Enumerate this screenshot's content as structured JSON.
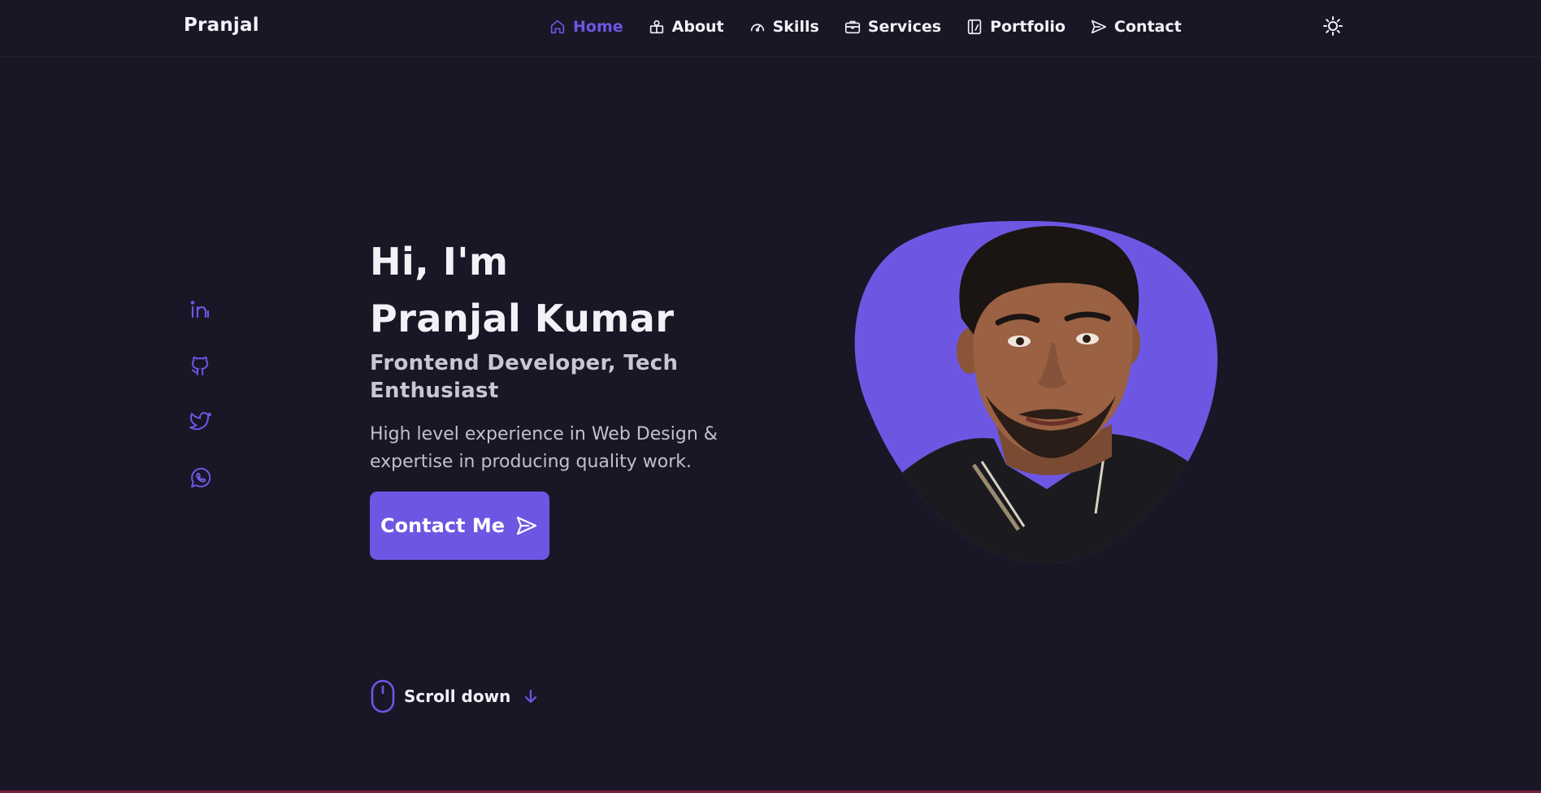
{
  "header": {
    "logo": "Pranjal",
    "nav": [
      {
        "label": "Home",
        "icon": "home-icon",
        "active": true
      },
      {
        "label": "About",
        "icon": "user-icon",
        "active": false
      },
      {
        "label": "Skills",
        "icon": "gauge-icon",
        "active": false
      },
      {
        "label": "Services",
        "icon": "briefcase-icon",
        "active": false
      },
      {
        "label": "Portfolio",
        "icon": "portfolio-icon",
        "active": false
      },
      {
        "label": "Contact",
        "icon": "send-icon",
        "active": false
      }
    ],
    "theme_icon": "sun-icon"
  },
  "social": [
    {
      "name": "linkedin",
      "icon": "linkedin-icon"
    },
    {
      "name": "github",
      "icon": "github-icon"
    },
    {
      "name": "twitter",
      "icon": "twitter-icon"
    },
    {
      "name": "whatsapp",
      "icon": "whatsapp-icon"
    }
  ],
  "hero": {
    "greeting": "Hi, I'm",
    "name": "Pranjal Kumar",
    "subtitle": "Frontend Developer, Tech Enthusiast",
    "description": "High level experience in Web Design & expertise in producing quality work.",
    "button_label": "Contact Me"
  },
  "scroll": {
    "label": "Scroll down"
  },
  "colors": {
    "background": "#191626",
    "accent": "#6d57e2",
    "text": "#f2f1f7",
    "muted": "#c2bfcf"
  }
}
